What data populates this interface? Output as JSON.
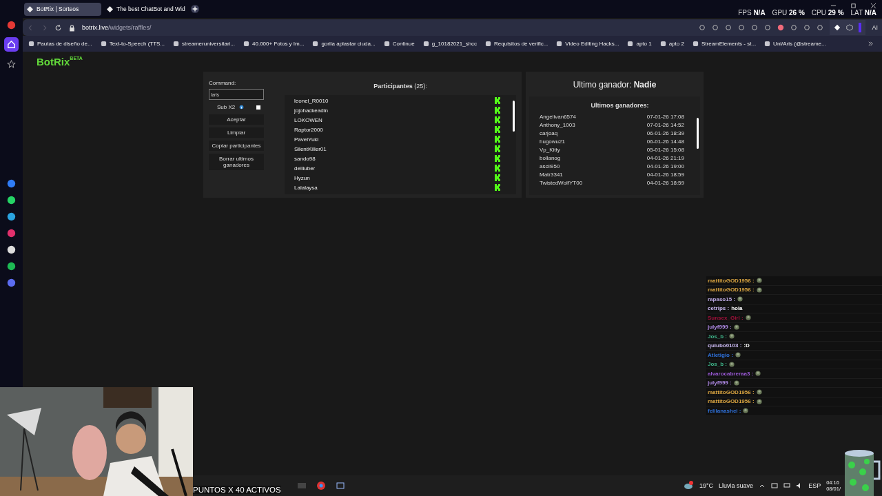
{
  "browser": {
    "tabs": [
      {
        "title": "BotRix | Sorteos",
        "selected": true
      },
      {
        "title": "The best ChatBot and Wid",
        "selected": false
      }
    ],
    "url_host": "botrix.live",
    "url_path": "/widgets/raffles/",
    "bookmarks": [
      "Pautas de diseño de...",
      "Text-to-Speech (TTS...",
      "streameruniversitari...",
      "40.000+ Fotos y Im...",
      "gorila aplastar ciuda...",
      "Continue",
      "g_10182021_shcc",
      "Requisitos de verific...",
      "Video Editing Hacks...",
      "apto 1",
      "apto 2",
      "StreamElements - st...",
      "Uni/Aris (@streame..."
    ],
    "stats": [
      {
        "label": "FPS",
        "value": "N/A"
      },
      {
        "label": "GPU",
        "value": "26 %"
      },
      {
        "label": "CPU",
        "value": "29 %"
      },
      {
        "label": "LAT",
        "value": "N/A"
      }
    ],
    "ai_label": "AI"
  },
  "app": {
    "logo": "BotRix",
    "badge": "BETA"
  },
  "raffle": {
    "command_label": "Command:",
    "command_value": "laris",
    "sub_label": "Sub X2",
    "sub_checked": false,
    "buttons": [
      "Aceptar",
      "Limpiar",
      "Copiar participantes",
      "Borrar ultimos ganadores"
    ],
    "participants_title": "Participantes",
    "participants_count": "(25):",
    "participants": [
      "leonel_R0010",
      "jojohackeadin",
      "LOKOWEN",
      "Raptor2000",
      "PavelYuki",
      "SilentKiller01",
      "sando98",
      "delliuber",
      "Hyzun",
      "Lalalaysa"
    ],
    "last_winner_label": "Ultimo ganador:",
    "last_winner": "Nadie",
    "winners_title": "Ultimos ganadores:",
    "winners": [
      {
        "name": "Angelivan6574",
        "date": "07-01-26 17:08"
      },
      {
        "name": "Anthony_1003",
        "date": "07-01-26 14:52"
      },
      {
        "name": "carjoaq",
        "date": "06-01-26 18:39"
      },
      {
        "name": "hugowu21",
        "date": "06-01-26 14:48"
      },
      {
        "name": "Vp_Kitty",
        "date": "05-01-26 15:08"
      },
      {
        "name": "bollanog",
        "date": "04-01-26 21:19"
      },
      {
        "name": "ascii950",
        "date": "04-01-26 19:00"
      },
      {
        "name": "Matr3341",
        "date": "04-01-26 18:59"
      },
      {
        "name": "TwistedWolfYT00",
        "date": "04-01-26 18:59"
      }
    ]
  },
  "chat": [
    {
      "user": "mattitoGOD1956 :",
      "color": "#d9a441",
      "kind": "emote"
    },
    {
      "user": "mattitoGOD1956 :",
      "color": "#d9a441",
      "kind": "emote"
    },
    {
      "user": "rapaso15 :",
      "color": "#b9a7e0",
      "kind": "emote"
    },
    {
      "user": "cetrips :",
      "color": "#c9b8f0",
      "kind": "text",
      "text": "hola"
    },
    {
      "user": "Sunsex_Girl :",
      "color": "#a0103a",
      "kind": "emote"
    },
    {
      "user": "julyf999 :",
      "color": "#b08ae6",
      "kind": "emote"
    },
    {
      "user": "Jos_b :",
      "color": "#3fb58a",
      "kind": "emote"
    },
    {
      "user": "quiubo0103 :",
      "color": "#c9b8f0",
      "kind": "text",
      "text": ":D"
    },
    {
      "user": "Atletigio :",
      "color": "#2e6fd6",
      "kind": "emote"
    },
    {
      "user": "Jos_b :",
      "color": "#3fb58a",
      "kind": "emote"
    },
    {
      "user": "alvarocabreraa3 :",
      "color": "#9b59d6",
      "kind": "emote"
    },
    {
      "user": "julyf999 :",
      "color": "#b08ae6",
      "kind": "emote"
    },
    {
      "user": "mattitoGOD1956 :",
      "color": "#d9a441",
      "kind": "emote"
    },
    {
      "user": "mattitoGOD1956 :",
      "color": "#d9a441",
      "kind": "emote"
    },
    {
      "user": "felilanashei :",
      "color": "#2e6fd6",
      "kind": "emote"
    }
  ],
  "overlay_text": "PUNTOS X 40 ACTIVOS",
  "taskbar": {
    "temperature": "19°C",
    "weather": "Lluvia suave",
    "language": "ESP",
    "time": "04:16",
    "date": "08/01/"
  }
}
